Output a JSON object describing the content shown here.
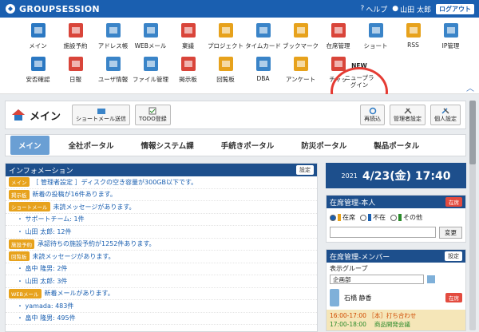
{
  "header": {
    "logo": "GROUPSESSION",
    "help": "ヘルプ",
    "user": "山田 太郎",
    "logout": "ログアウト"
  },
  "icons_row1": [
    {
      "label": "メイン",
      "icon": "home-icon"
    },
    {
      "label": "施設予約",
      "icon": "facility-icon"
    },
    {
      "label": "アドレス帳",
      "icon": "address-book-icon"
    },
    {
      "label": "WEBメール",
      "icon": "webmail-icon"
    },
    {
      "label": "稟議",
      "icon": "approval-icon"
    },
    {
      "label": "プロジェクト",
      "icon": "project-icon"
    },
    {
      "label": "タイムカード",
      "icon": "timecard-icon"
    },
    {
      "label": "ブックマーク",
      "icon": "bookmark-icon"
    },
    {
      "label": "在席管理",
      "icon": "presence-icon"
    },
    {
      "label": "ショート",
      "icon": "shortmail-icon"
    },
    {
      "label": "RSS",
      "icon": "rss-icon"
    },
    {
      "label": "IP管理",
      "icon": "ip-icon"
    }
  ],
  "icons_row2": [
    {
      "label": "安否確認",
      "icon": "safety-icon"
    },
    {
      "label": "日報",
      "icon": "report-icon"
    },
    {
      "label": "ユーザ情報",
      "icon": "user-info-icon"
    },
    {
      "label": "ファイル管理",
      "icon": "file-icon"
    },
    {
      "label": "掲示板",
      "icon": "bulletin-icon"
    },
    {
      "label": "回覧板",
      "icon": "circular-icon"
    },
    {
      "label": "DBA",
      "icon": "dba-icon"
    },
    {
      "label": "アンケート",
      "icon": "survey-icon"
    },
    {
      "label": "チャッ",
      "icon": "chat-icon"
    }
  ],
  "new_item": {
    "tag": "NEW",
    "label_line1": "ニュープラ",
    "label_line2": "グイン"
  },
  "main": {
    "title": "メイン",
    "btn_shortmail": "ショートメール送信",
    "btn_todo": "TODO登録",
    "btn_reload": "再読込",
    "btn_admin": "管理者設定",
    "btn_personal": "個人設定"
  },
  "tabs": [
    "メイン",
    "全社ポータル",
    "情報システム課",
    "手続きポータル",
    "防災ポータル",
    "製品ポータル"
  ],
  "info": {
    "title": "インフォメーション",
    "setting": "設定",
    "rows": [
      {
        "tag": "メイン",
        "tagColor": "#e7a21c",
        "text": "［ 管理者設定 ］ディスクの空き容量が300GB以下です。",
        "sub": false
      },
      {
        "tag": "掲示板",
        "tagColor": "#e7a21c",
        "text": "新着の投稿が16件あります。",
        "sub": false
      },
      {
        "tag": "ショートメール",
        "tagColor": "#e7a21c",
        "text": "未読メッセージがあります。",
        "sub": false
      },
      {
        "tag": "",
        "tagColor": "",
        "text": "・ サポートチーム: 1件",
        "sub": true
      },
      {
        "tag": "",
        "tagColor": "",
        "text": "・ 山田 太郎: 12件",
        "sub": true
      },
      {
        "tag": "施設予約",
        "tagColor": "#e7a21c",
        "text": "承認待ちの施設予約が1252件あります。",
        "sub": false
      },
      {
        "tag": "回覧板",
        "tagColor": "#e7a21c",
        "text": "未読メッセージがあります。",
        "sub": false
      },
      {
        "tag": "",
        "tagColor": "",
        "text": "・ 畠中 隆男: 2件",
        "sub": true
      },
      {
        "tag": "",
        "tagColor": "",
        "text": "・ 山田 太郎: 3件",
        "sub": true
      },
      {
        "tag": "WEBメール",
        "tagColor": "#e7a21c",
        "text": "新着メールがあります。",
        "sub": false
      },
      {
        "tag": "",
        "tagColor": "",
        "text": "・ yamada: 483件",
        "sub": true
      },
      {
        "tag": "",
        "tagColor": "",
        "text": "・ 畠中 隆男: 495件",
        "sub": true
      }
    ]
  },
  "clock": {
    "year": "2021",
    "date": "4/23(金) 17:40"
  },
  "presence_self": {
    "title": "在席管理-本人",
    "status_tag": "在席",
    "options": [
      "在席",
      "不在",
      "その他"
    ],
    "change": "変更"
  },
  "presence_members": {
    "title": "在席管理-メンバー",
    "setting": "設定",
    "group_label": "表示グループ",
    "group_value": "企画部",
    "member_name": "石橋 静香",
    "member_status": "在席",
    "sched1": "16:00-17:00 ［本］打ち合わせ",
    "sched2": "17:00-18:00 　商品開発会議"
  }
}
